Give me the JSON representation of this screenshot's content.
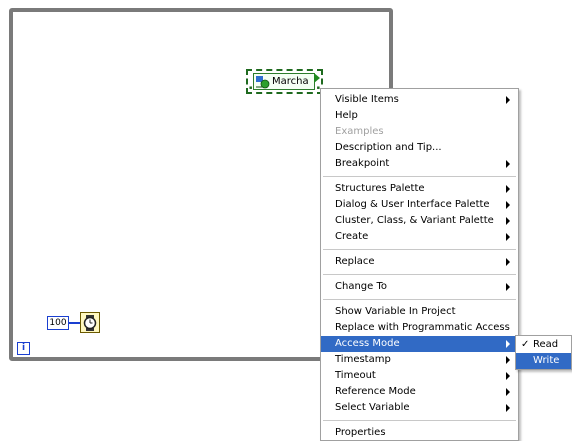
{
  "diagram": {
    "iteration_terminal": "i",
    "constant_value": "100",
    "shared_variable_label": "Marcha",
    "icons": [
      "while-loop",
      "iteration-terminal",
      "wait-ms-icon",
      "shared-variable-icon"
    ]
  },
  "menu": {
    "groups": [
      [
        {
          "label": "Visible Items",
          "submenu": true,
          "disabled": false
        },
        {
          "label": "Help",
          "submenu": false,
          "disabled": false
        },
        {
          "label": "Examples",
          "submenu": false,
          "disabled": true
        },
        {
          "label": "Description and Tip...",
          "submenu": false,
          "disabled": false
        },
        {
          "label": "Breakpoint",
          "submenu": true,
          "disabled": false
        }
      ],
      [
        {
          "label": "Structures Palette",
          "submenu": true,
          "disabled": false
        },
        {
          "label": "Dialog & User Interface Palette",
          "submenu": true,
          "disabled": false
        },
        {
          "label": "Cluster, Class, & Variant Palette",
          "submenu": true,
          "disabled": false
        },
        {
          "label": "Create",
          "submenu": true,
          "disabled": false
        }
      ],
      [
        {
          "label": "Replace",
          "submenu": true,
          "disabled": false
        }
      ],
      [
        {
          "label": "Change To",
          "submenu": true,
          "disabled": false
        }
      ],
      [
        {
          "label": "Show Variable In Project",
          "submenu": false,
          "disabled": false
        },
        {
          "label": "Replace with Programmatic Access",
          "submenu": false,
          "disabled": false
        },
        {
          "label": "Access Mode",
          "submenu": true,
          "disabled": false,
          "highlighted": true
        },
        {
          "label": "Timestamp",
          "submenu": true,
          "disabled": false
        },
        {
          "label": "Timeout",
          "submenu": true,
          "disabled": false
        },
        {
          "label": "Reference Mode",
          "submenu": true,
          "disabled": false
        },
        {
          "label": "Select Variable",
          "submenu": true,
          "disabled": false
        }
      ],
      [
        {
          "label": "Properties",
          "submenu": false,
          "disabled": false
        }
      ]
    ]
  },
  "submenu": {
    "items": [
      {
        "label": "Read",
        "checked": true
      },
      {
        "label": "Write",
        "checked": false,
        "highlighted": true
      }
    ]
  },
  "colors": {
    "highlight": "#316ac5",
    "loop_border": "#7a7a7a",
    "numeric_blue": "#1a3fd0",
    "sv_green": "#1f6a1f"
  }
}
